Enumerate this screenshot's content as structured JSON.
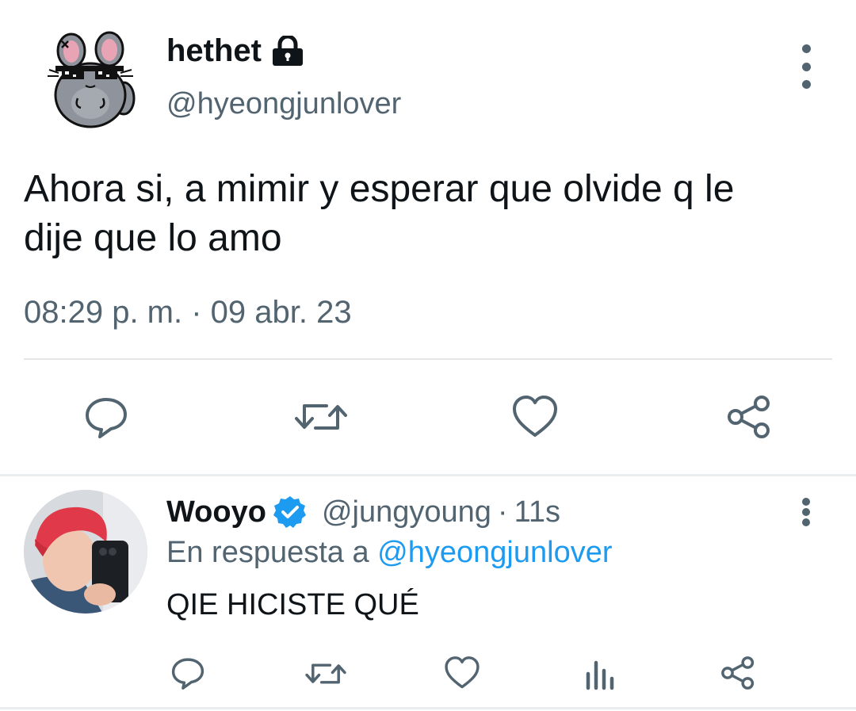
{
  "main_tweet": {
    "display_name": "hethet",
    "handle": "@hyeongjunlover",
    "text_line1": "Ahora si, a mimir y esperar que olvide q le",
    "text_line2": "dije que lo amo",
    "timestamp": "08:29 p. m. · 09 abr. 23",
    "icons": {
      "protected": "lock-icon",
      "more": "more-vertical-icon",
      "reply": "reply-icon",
      "retweet": "retweet-icon",
      "like": "like-icon",
      "share": "share-icon"
    }
  },
  "reply_tweet": {
    "display_name": "Wooyo",
    "handle": "@jungyoung",
    "separator": "·",
    "time_ago": "11s",
    "reply_prefix": "En respuesta a",
    "reply_to": "@hyeongjunlover",
    "text": "QIE HICISTE QUÉ",
    "icons": {
      "verified": "verified-badge-icon",
      "more": "more-vertical-icon",
      "reply": "reply-icon",
      "retweet": "retweet-icon",
      "like": "like-icon",
      "analytics": "analytics-icon",
      "share": "share-icon"
    }
  },
  "colors": {
    "text": "#0f1419",
    "muted": "#536471",
    "accent": "#1d9bf0",
    "divider": "#e6e6e6"
  }
}
